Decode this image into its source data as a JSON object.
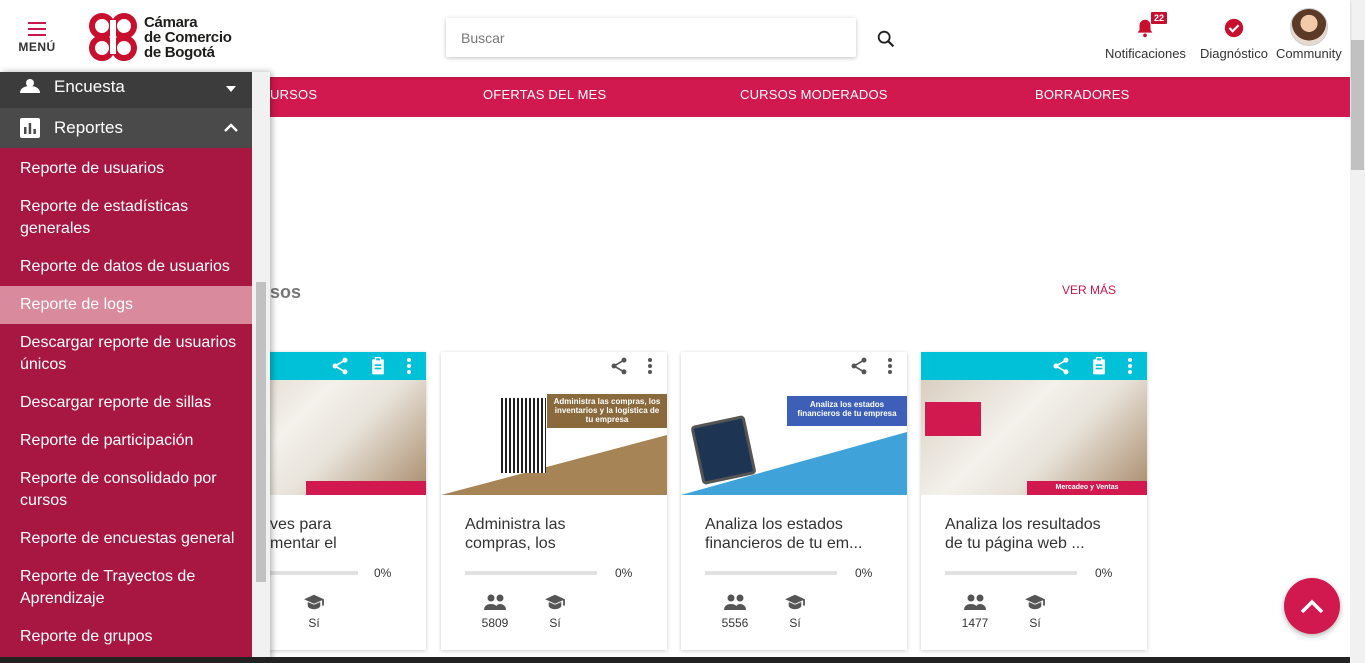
{
  "header": {
    "menu_label": "MENÚ",
    "logo_line1": "Cámara",
    "logo_line2": "de Comercio",
    "logo_line3": "de Bogotá",
    "search_placeholder": "Buscar",
    "notifications_label": "Notificaciones",
    "notifications_count": "22",
    "diagnostic_label": "Diagnóstico",
    "community_label": "Community"
  },
  "navbar": {
    "items": [
      "URSOS",
      "OFERTAS DEL MES",
      "CURSOS MODERADOS",
      "BORRADORES"
    ]
  },
  "section": {
    "title": "sos",
    "see_more": "VER MÁS"
  },
  "cards": [
    {
      "title": "ves para\nmentar el",
      "progress": "0%",
      "users": "",
      "certificate": "Sí"
    },
    {
      "title": "Administra las\ncompras, los",
      "progress": "0%",
      "users": "5809",
      "certificate": "Sí",
      "image_text": "Administra las compras, los inventarios y la logística de tu empresa"
    },
    {
      "title": "Analiza los estados\nfinancieros de tu em...",
      "progress": "0%",
      "users": "5556",
      "certificate": "Sí",
      "image_text": "Analiza los estados financieros de tu empresa"
    },
    {
      "title": "Analiza los resultados\nde tu página web ...",
      "progress": "0%",
      "users": "1477",
      "certificate": "Sí",
      "image_text": "Mercadeo y Ventas"
    }
  ],
  "sidebar": {
    "partial_item": "Encuesta",
    "section_label": "Reportes",
    "items": [
      "Reporte de usuarios",
      "Reporte de estadísticas generales",
      "Reporte de datos de usuarios",
      "Reporte de logs",
      "Descargar reporte de usuarios únicos",
      "Descargar reporte de sillas",
      "Reporte de participación",
      "Reporte de consolidado por cursos",
      "Reporte de encuestas general",
      "Reporte de Trayectos de Aprendizaje",
      "Reporte de grupos"
    ],
    "active_index": 3
  },
  "colors": {
    "brand": "#d1184f",
    "sidebar": "#a81642",
    "accent_cyan": "#00c1d8"
  }
}
